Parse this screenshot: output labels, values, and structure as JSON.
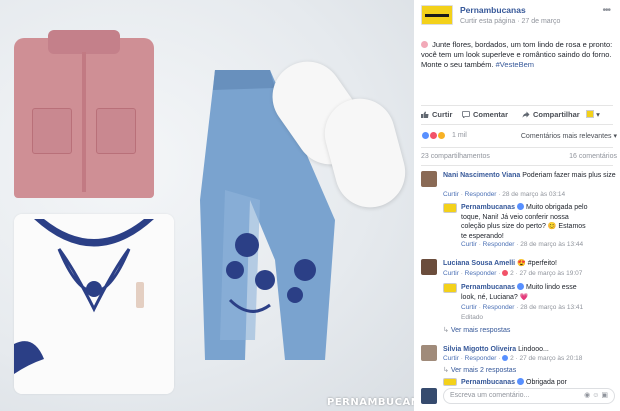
{
  "photo": {
    "watermark": "PERNAMBUCANAS"
  },
  "post": {
    "page_name": "Pernambucanas",
    "follow_label": "Curtir esta página",
    "date": "27 de março",
    "text": "Junte flores, bordados, um tom lindo de rosa e pronto: você tem um look superleve e romântico saindo do forno. Monte o seu também.",
    "hashtag": "#VesteBem",
    "actions": {
      "like": "Curtir",
      "comment": "Comentar",
      "share": "Compartilhar"
    },
    "reaction_count": "1 mil",
    "relevance_label": "Comentários mais relevantes",
    "shares": "23 compartilhamentos",
    "comment_count": "16 comentários"
  },
  "comments": [
    {
      "name": "Nani Nascimento Viana",
      "text": "Poderiam fazer mais plus size",
      "like": "Curtir",
      "reply": "Responder",
      "date": "28 de março às 03:14"
    },
    {
      "name": "Pernambucanas",
      "text": "Muito obrigada pelo toque, Nani! Já veio conferir nossa coleção plus size do perto? 😊 Estamos te esperando!",
      "like": "Curtir",
      "reply": "Responder",
      "date": "28 de março às 13:44"
    },
    {
      "name": "Luciana Sousa Amelli",
      "text": "😍 #perfeito!",
      "like": "Curtir",
      "reply": "Responder",
      "reactions": "2",
      "date": "27 de março às 19:07"
    },
    {
      "name": "Pernambucanas",
      "text": "Muito lindo esse look, né, Luciana? 💗",
      "like": "Curtir",
      "reply": "Responder",
      "date": "28 de março às 13:41",
      "edited": "Editado"
    },
    {
      "name": "Silvia Migotto Oliveira",
      "text": "Lindooo...",
      "like": "Curtir",
      "reply": "Responder",
      "reactions": "2",
      "date": "27 de março às 20:18"
    },
    {
      "name": "Pernambucanas",
      "text": "Obrigada por"
    }
  ],
  "more_replies_1": "Ver mais respostas",
  "more_replies_2": "Ver mais 2 respostas",
  "write": {
    "placeholder": "Escreva um comentário..."
  },
  "colors": {
    "link": "#365899",
    "meta": "#90949c",
    "like_blue": "#5890ff",
    "love_red": "#f25268",
    "brand_yellow": "#f3d11a"
  }
}
